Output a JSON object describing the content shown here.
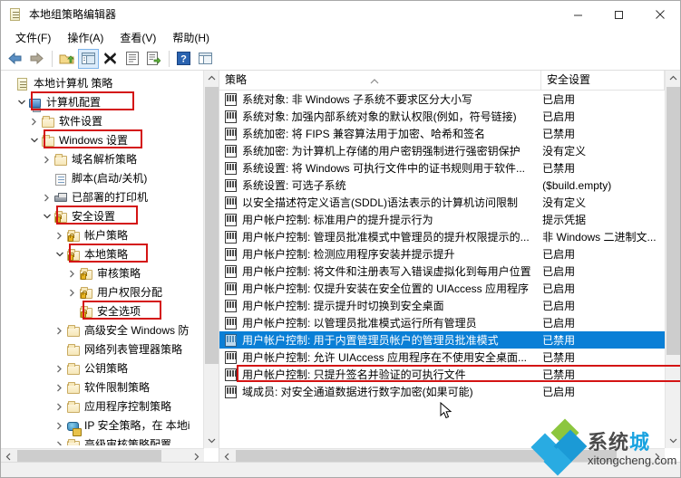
{
  "window": {
    "title": "本地组策略编辑器",
    "icon": "console-document-icon",
    "buttons": {
      "minimize": "—",
      "maximize": "□",
      "close": "✕"
    }
  },
  "menubar": {
    "items": [
      {
        "label": "文件(F)",
        "name": "menu-file"
      },
      {
        "label": "操作(A)",
        "name": "menu-action"
      },
      {
        "label": "查看(V)",
        "name": "menu-view"
      },
      {
        "label": "帮助(H)",
        "name": "menu-help"
      }
    ]
  },
  "toolbar": {
    "buttons": [
      {
        "name": "back-button",
        "icon": "back-arrow-icon",
        "title": "后退"
      },
      {
        "name": "forward-button",
        "icon": "forward-arrow-icon",
        "title": "前进"
      },
      {
        "name": "up-button",
        "icon": "up-folder-icon",
        "title": "上移一级"
      },
      {
        "name": "show-hide-tree-button",
        "icon": "show-hide-console-tree-icon",
        "title": "显示/隐藏控制台树",
        "pressed": true
      },
      {
        "name": "delete-button",
        "icon": "delete-x-icon",
        "title": "删除"
      },
      {
        "name": "properties-button",
        "icon": "properties-icon",
        "title": "属性"
      },
      {
        "name": "export-list-button",
        "icon": "export-list-icon",
        "title": "导出列表"
      },
      {
        "name": "help-button",
        "icon": "help-question-icon",
        "title": "帮助"
      },
      {
        "name": "view-button",
        "icon": "view-layout-icon",
        "title": "查看"
      }
    ]
  },
  "tree": {
    "nodes": [
      {
        "label": "本地计算机 策略",
        "icon": "console-root-icon",
        "indent": 0,
        "chevron": "",
        "highlight": false
      },
      {
        "label": "计算机配置",
        "icon": "computer-icon",
        "indent": 1,
        "chevron": "v",
        "highlight": true
      },
      {
        "label": "软件设置",
        "icon": "folder-icon",
        "indent": 2,
        "chevron": ">",
        "highlight": false
      },
      {
        "label": "Windows 设置",
        "icon": "folder-icon",
        "indent": 2,
        "chevron": "v",
        "highlight": true
      },
      {
        "label": "域名解析策略",
        "icon": "folder-icon",
        "indent": 3,
        "chevron": ">",
        "highlight": false
      },
      {
        "label": "脚本(启动/关机)",
        "icon": "script-icon",
        "indent": 3,
        "chevron": "",
        "highlight": false
      },
      {
        "label": "已部署的打印机",
        "icon": "printer-icon",
        "indent": 3,
        "chevron": ">",
        "highlight": false
      },
      {
        "label": "安全设置",
        "icon": "security-settings-icon",
        "indent": 3,
        "chevron": "v",
        "highlight": true
      },
      {
        "label": "帐户策略",
        "icon": "folder-lock-icon",
        "indent": 4,
        "chevron": ">",
        "highlight": false
      },
      {
        "label": "本地策略",
        "icon": "folder-lock-icon",
        "indent": 4,
        "chevron": "v",
        "highlight": true
      },
      {
        "label": "审核策略",
        "icon": "folder-lock-icon",
        "indent": 5,
        "chevron": ">",
        "highlight": false
      },
      {
        "label": "用户权限分配",
        "icon": "folder-lock-icon",
        "indent": 5,
        "chevron": ">",
        "highlight": false
      },
      {
        "label": "安全选项",
        "icon": "folder-lock-icon",
        "indent": 5,
        "chevron": "",
        "highlight": true
      },
      {
        "label": "高级安全 Windows 防",
        "icon": "folder-icon",
        "indent": 4,
        "chevron": ">",
        "highlight": false
      },
      {
        "label": "网络列表管理器策略",
        "icon": "folder-icon",
        "indent": 4,
        "chevron": "",
        "highlight": false
      },
      {
        "label": "公钥策略",
        "icon": "folder-icon",
        "indent": 4,
        "chevron": ">",
        "highlight": false
      },
      {
        "label": "软件限制策略",
        "icon": "folder-icon",
        "indent": 4,
        "chevron": ">",
        "highlight": false
      },
      {
        "label": "应用程序控制策略",
        "icon": "folder-icon",
        "indent": 4,
        "chevron": ">",
        "highlight": false
      },
      {
        "label": "IP 安全策略，在 本地i",
        "icon": "ip-security-icon",
        "indent": 4,
        "chevron": ">",
        "highlight": false
      },
      {
        "label": "高级审核策略配置",
        "icon": "folder-icon",
        "indent": 4,
        "chevron": ">",
        "highlight": false
      }
    ]
  },
  "list": {
    "columns": [
      {
        "label": "策略",
        "name": "column-policy",
        "sorted": true
      },
      {
        "label": "安全设置",
        "name": "column-security-setting",
        "sorted": false
      }
    ],
    "rows": [
      {
        "policy": "系统对象: 非 Windows 子系统不要求区分大小写",
        "setting": "已启用",
        "selected": false
      },
      {
        "policy": "系统对象: 加强内部系统对象的默认权限(例如，符号链接)",
        "setting": "已启用",
        "selected": false
      },
      {
        "policy": "系统加密: 将 FIPS 兼容算法用于加密、哈希和签名",
        "setting": "已禁用",
        "selected": false
      },
      {
        "policy": "系统加密: 为计算机上存储的用户密钥强制进行强密钥保护",
        "setting": "没有定义",
        "selected": false
      },
      {
        "policy": "系统设置: 将 Windows 可执行文件中的证书规则用于软件...",
        "setting": "已禁用",
        "selected": false
      },
      {
        "policy": "系统设置: 可选子系统",
        "setting": "($build.empty)",
        "selected": false
      },
      {
        "policy": "以安全描述符定义语言(SDDL)语法表示的计算机访问限制",
        "setting": "没有定义",
        "selected": false
      },
      {
        "policy": "用户帐户控制: 标准用户的提升提示行为",
        "setting": "提示凭据",
        "selected": false
      },
      {
        "policy": "用户帐户控制: 管理员批准模式中管理员的提升权限提示的...",
        "setting": "非 Windows 二进制文...",
        "selected": false
      },
      {
        "policy": "用户帐户控制: 检测应用程序安装并提示提升",
        "setting": "已启用",
        "selected": false
      },
      {
        "policy": "用户帐户控制: 将文件和注册表写入错误虚拟化到每用户位置",
        "setting": "已启用",
        "selected": false
      },
      {
        "policy": "用户帐户控制: 仅提升安装在安全位置的 UIAccess 应用程序",
        "setting": "已启用",
        "selected": false
      },
      {
        "policy": "用户帐户控制: 提示提升时切换到安全桌面",
        "setting": "已启用",
        "selected": false
      },
      {
        "policy": "用户帐户控制: 以管理员批准模式运行所有管理员",
        "setting": "已启用",
        "selected": false
      },
      {
        "policy": "用户帐户控制: 用于内置管理员帐户的管理员批准模式",
        "setting": "已禁用",
        "selected": true
      },
      {
        "policy": "用户帐户控制: 允许 UIAccess 应用程序在不使用安全桌面...",
        "setting": "已禁用",
        "selected": false
      },
      {
        "policy": "用户帐户控制: 只提升签名并验证的可执行文件",
        "setting": "已禁用",
        "selected": false
      },
      {
        "policy": "域成员: 对安全通道数据进行数字加密(如果可能)",
        "setting": "已启用",
        "selected": false
      }
    ]
  },
  "watermark": {
    "text_dark": "系统",
    "text_blue": "城",
    "url": "xitongcheng.com"
  },
  "colors": {
    "selection": "#0a7fd6",
    "annotation": "#d41414",
    "toolbar_pressed": "#dcecfb",
    "watermark_blue": "#1aa3e0"
  }
}
